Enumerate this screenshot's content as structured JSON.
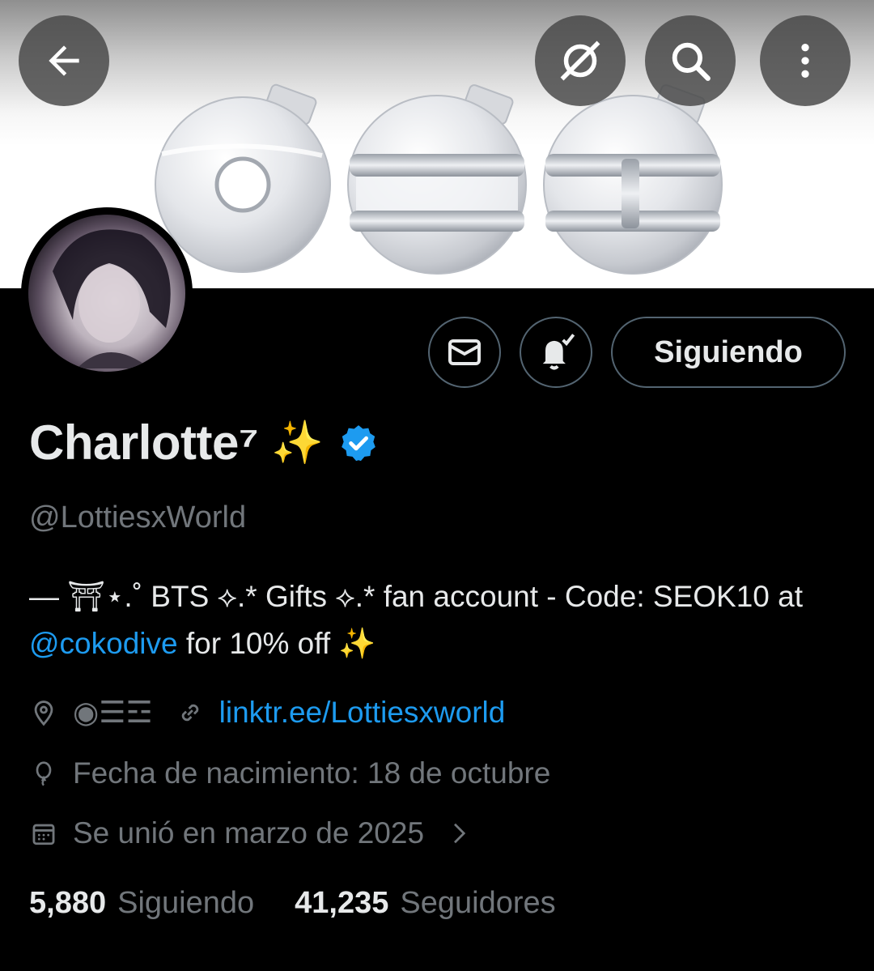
{
  "header": {
    "back_icon": "arrow-left-icon",
    "grok_icon": "grok-icon",
    "search_icon": "search-icon",
    "more_icon": "more-vertical-icon"
  },
  "profile": {
    "display_name": "Charlotte⁷",
    "name_emoji": "✨",
    "verified": true,
    "handle": "@LottiesxWorld",
    "bio_part1": "— ⛩⋆.˚ BTS ⟡.* Gifts ⟡.* fan account - Code: SEOK10 at ",
    "bio_mention": "@cokodive",
    "bio_part2": " for 10% off ✨",
    "location": "◉☰☲",
    "website": "linktr.ee/Lottiesxworld",
    "birthday": "Fecha de nacimiento: 18 de octubre",
    "joined": "Se unió en marzo de 2025"
  },
  "actions": {
    "message_icon": "mail-icon",
    "notify_icon": "bell-check-icon",
    "follow_label": "Siguiendo"
  },
  "stats": {
    "following_count": "5,880",
    "following_label": "Siguiendo",
    "followers_count": "41,235",
    "followers_label": "Seguidores"
  },
  "colors": {
    "background": "#000000",
    "accent": "#1d9bf0",
    "secondary_text": "#71767b",
    "border": "#536471"
  }
}
